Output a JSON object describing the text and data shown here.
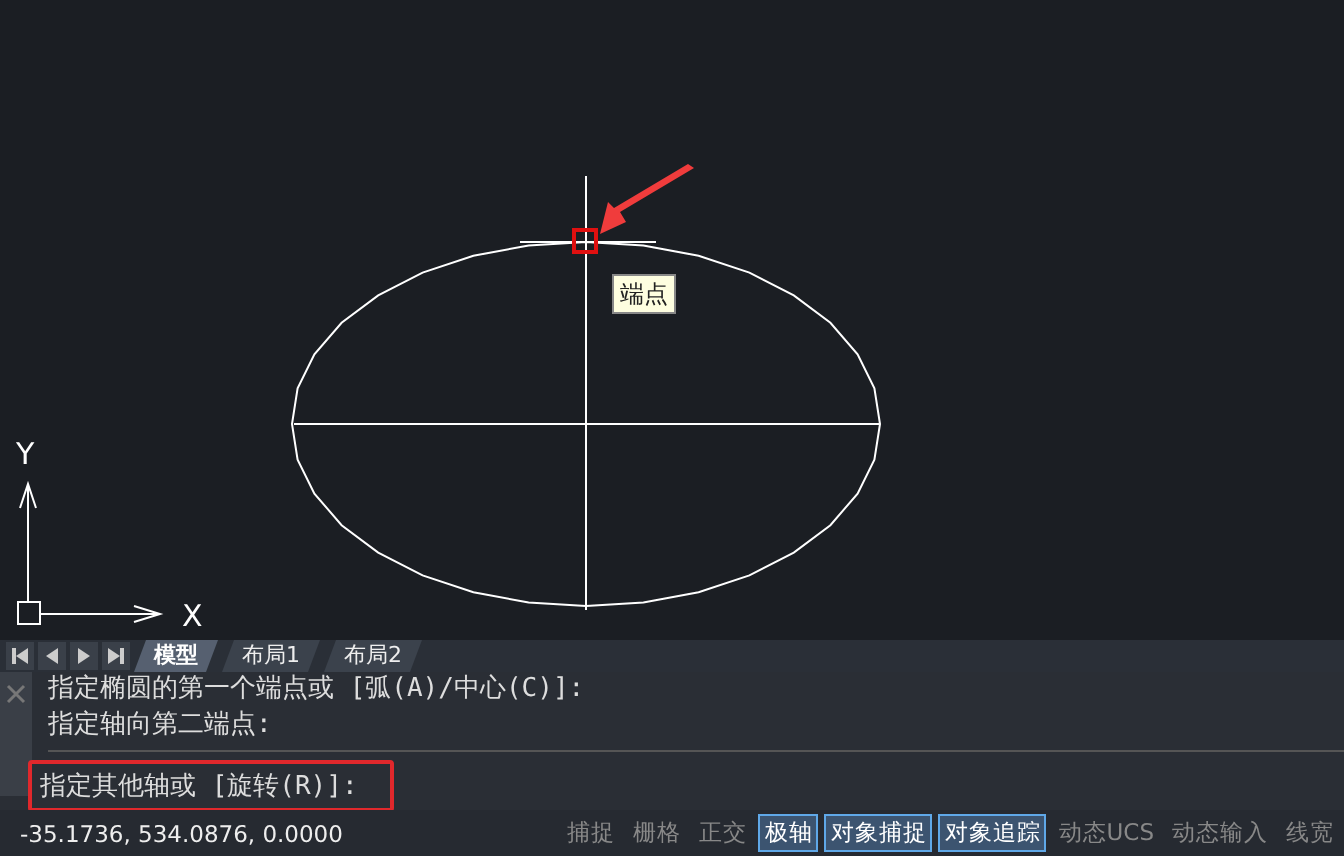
{
  "canvas": {
    "tooltip": "端点",
    "axis_y": "Y",
    "axis_x": "X"
  },
  "tabs": [
    {
      "label": "模型",
      "selected": true
    },
    {
      "label": "布局1",
      "selected": false
    },
    {
      "label": "布局2",
      "selected": false
    }
  ],
  "command_history": [
    "指定椭圆的第一个端点或 [弧(A)/中心(C)]:",
    "指定轴向第二端点:"
  ],
  "command_prompt": "指定其他轴或 [旋转(R)]:",
  "status_bar": {
    "coordinates": "-35.1736, 534.0876, 0.0000",
    "toggles": [
      {
        "label": "捕捉",
        "on": false
      },
      {
        "label": "栅格",
        "on": false
      },
      {
        "label": "正交",
        "on": false
      },
      {
        "label": "极轴",
        "on": true
      },
      {
        "label": "对象捕捉",
        "on": true
      },
      {
        "label": "对象追踪",
        "on": true
      },
      {
        "label": "动态UCS",
        "on": false
      },
      {
        "label": "动态输入",
        "on": false
      },
      {
        "label": "线宽",
        "on": false
      }
    ]
  }
}
